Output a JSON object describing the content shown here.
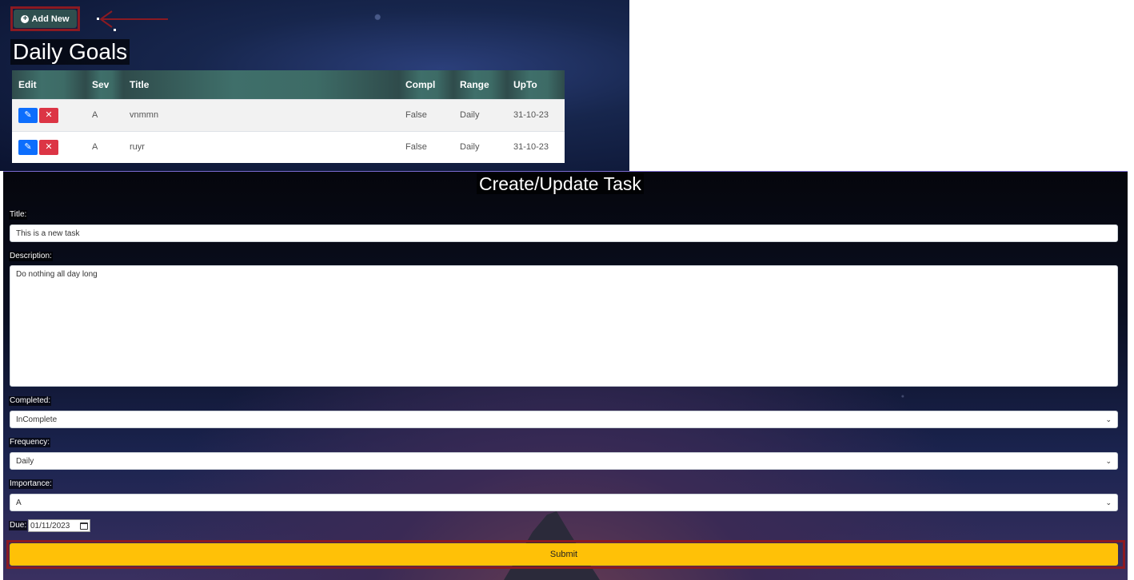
{
  "toolbar": {
    "add_new_label": "Add New",
    "add_new_icon": "plus-circle-icon"
  },
  "goals": {
    "title": "Daily Goals",
    "columns": [
      "Edit",
      "Sev",
      "Title",
      "Compl",
      "Range",
      "UpTo"
    ],
    "rows": [
      {
        "sev": "A",
        "title": "vnmmn",
        "compl": "False",
        "range": "Daily",
        "upto": "31-10-23"
      },
      {
        "sev": "A",
        "title": "ruyr",
        "compl": "False",
        "range": "Daily",
        "upto": "31-10-23"
      }
    ],
    "edit_icon": "pencil-icon",
    "delete_icon": "x-icon"
  },
  "form": {
    "title": "Create/Update Task",
    "title_label": "Title:",
    "title_value": "This is a new task",
    "description_label": "Description:",
    "description_value": "Do nothing all day long",
    "completed_label": "Completed:",
    "completed_value": "InComplete",
    "frequency_label": "Frequency:",
    "frequency_value": "Daily",
    "importance_label": "Importance:",
    "importance_value": "A",
    "due_label": "Due:",
    "due_value": "01/11/2023",
    "submit_label": "Submit"
  },
  "colors": {
    "add_button": "#2f4f4f",
    "edit_button": "#0d6efd",
    "delete_button": "#dc3545",
    "submit_button": "#ffc107",
    "annotation_outline": "#8b1a22"
  }
}
